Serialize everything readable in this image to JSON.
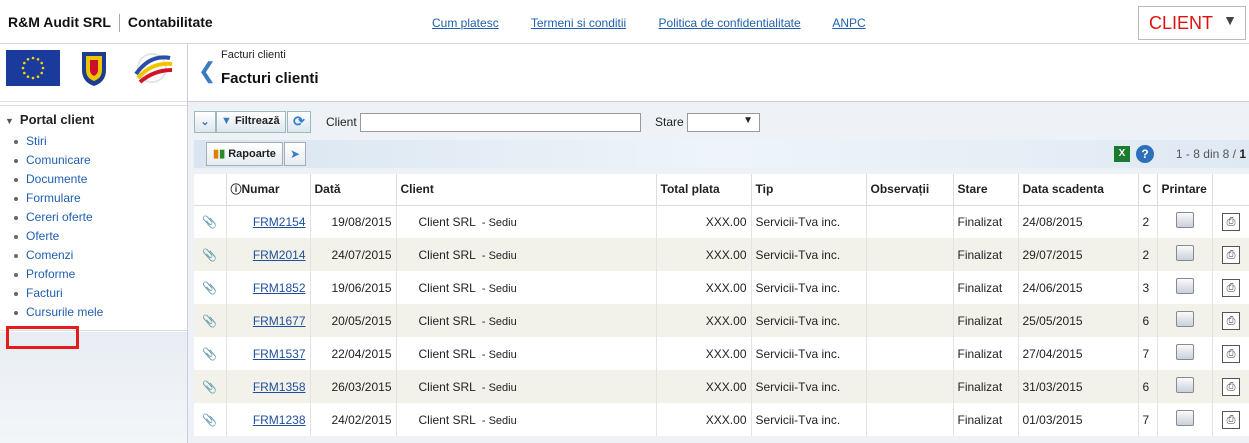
{
  "topbar": {
    "brand": "R&M Audit SRL",
    "section": "Contabilitate",
    "links": [
      "Cum platesc",
      "Termeni si conditii",
      "Politica de confidentialitate",
      "ANPC"
    ],
    "client_select": "CLIENT"
  },
  "sidebar": {
    "title": "Portal client",
    "items": [
      "Stiri",
      "Comunicare",
      "Documente",
      "Formulare",
      "Cereri oferte",
      "Oferte",
      "Comenzi",
      "Proforme",
      "Facturi",
      "Cursurile mele"
    ]
  },
  "header": {
    "breadcrumb": "Facturi clienti",
    "title": "Facturi clienti"
  },
  "toolbar": {
    "filter_label": "Filtrează",
    "client_label": "Client",
    "client_value": "",
    "stare_label": "Stare",
    "stare_value": "",
    "rapoarte_label": "Rapoarte",
    "paging_text": "1 - 8 din 8 /",
    "paging_pages": "1"
  },
  "table": {
    "headers": [
      "Numar",
      "Dată",
      "Client",
      "Total plata",
      "Tip",
      "Observații",
      "Stare",
      "Data scadenta",
      "C",
      "Printare"
    ],
    "rows": [
      {
        "numar": "FRM2154",
        "data": "19/08/2015",
        "client": "Client SRL",
        "sediu": "- Sediu",
        "total": "XXX.00",
        "tip": "Servicii-Tva inc.",
        "obs": "",
        "stare": "Finalizat",
        "scadenta": "24/08/2015",
        "c": "2"
      },
      {
        "numar": "FRM2014",
        "data": "24/07/2015",
        "client": "Client SRL",
        "sediu": "- Sediu",
        "total": "XXX.00",
        "tip": "Servicii-Tva inc.",
        "obs": "",
        "stare": "Finalizat",
        "scadenta": "29/07/2015",
        "c": "2"
      },
      {
        "numar": "FRM1852",
        "data": "19/06/2015",
        "client": "Client SRL",
        "sediu": "- Sediu",
        "total": "XXX.00",
        "tip": "Servicii-Tva inc.",
        "obs": "",
        "stare": "Finalizat",
        "scadenta": "24/06/2015",
        "c": "3"
      },
      {
        "numar": "FRM1677",
        "data": "20/05/2015",
        "client": "Client SRL",
        "sediu": "- Sediu",
        "total": "XXX.00",
        "tip": "Servicii-Tva inc.",
        "obs": "",
        "stare": "Finalizat",
        "scadenta": "25/05/2015",
        "c": "6"
      },
      {
        "numar": "FRM1537",
        "data": "22/04/2015",
        "client": "Client SRL",
        "sediu": "- Sediu",
        "total": "XXX.00",
        "tip": "Servicii-Tva inc.",
        "obs": "",
        "stare": "Finalizat",
        "scadenta": "27/04/2015",
        "c": "7"
      },
      {
        "numar": "FRM1358",
        "data": "26/03/2015",
        "client": "Client SRL",
        "sediu": "- Sediu",
        "total": "XXX.00",
        "tip": "Servicii-Tva inc.",
        "obs": "",
        "stare": "Finalizat",
        "scadenta": "31/03/2015",
        "c": "6"
      },
      {
        "numar": "FRM1238",
        "data": "24/02/2015",
        "client": "Client SRL",
        "sediu": "- Sediu",
        "total": "XXX.00",
        "tip": "Servicii-Tva inc.",
        "obs": "",
        "stare": "Finalizat",
        "scadenta": "01/03/2015",
        "c": "7"
      }
    ]
  },
  "icons": {
    "back": "chevron-left-icon",
    "attachment": "paperclip-icon",
    "print": "printer-icon",
    "excel": "excel-icon",
    "help": "help-icon"
  }
}
